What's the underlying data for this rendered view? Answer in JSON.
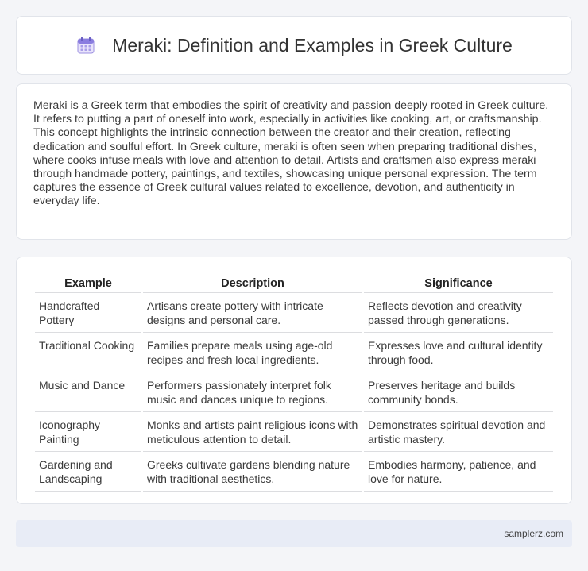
{
  "header": {
    "icon": "calendar-icon",
    "title": "Meraki: Definition and Examples in Greek Culture"
  },
  "intro": {
    "text": "Meraki is a Greek term that embodies the spirit of creativity and passion deeply rooted in Greek culture. It refers to putting a part of oneself into work, especially in activities like cooking, art, or craftsmanship. This concept highlights the intrinsic connection between the creator and their creation, reflecting dedication and soulful effort. In Greek culture, meraki is often seen when preparing traditional dishes, where cooks infuse meals with love and attention to detail. Artists and craftsmen also express meraki through handmade pottery, paintings, and textiles, showcasing unique personal expression. The term captures the essence of Greek cultural values related to excellence, devotion, and authenticity in everyday life."
  },
  "table": {
    "headers": [
      "Example",
      "Description",
      "Significance"
    ],
    "rows": [
      [
        "Handcrafted Pottery",
        "Artisans create pottery with intricate designs and personal care.",
        "Reflects devotion and creativity passed through generations."
      ],
      [
        "Traditional Cooking",
        "Families prepare meals using age-old recipes and fresh local ingredients.",
        "Expresses love and cultural identity through food."
      ],
      [
        "Music and Dance",
        "Performers passionately interpret folk music and dances unique to regions.",
        "Preserves heritage and builds community bonds."
      ],
      [
        "Iconography Painting",
        "Monks and artists paint religious icons with meticulous attention to detail.",
        "Demonstrates spiritual devotion and artistic mastery."
      ],
      [
        "Gardening and Landscaping",
        "Greeks cultivate gardens blending nature with traditional aesthetics.",
        "Embodies harmony, patience, and love for nature."
      ]
    ]
  },
  "footer": {
    "site": "samplerz.com"
  },
  "colors": {
    "background": "#f4f5f8",
    "card": "#ffffff",
    "footer_bg": "#e8ecf6",
    "icon_accent": "#7b6fd6"
  }
}
